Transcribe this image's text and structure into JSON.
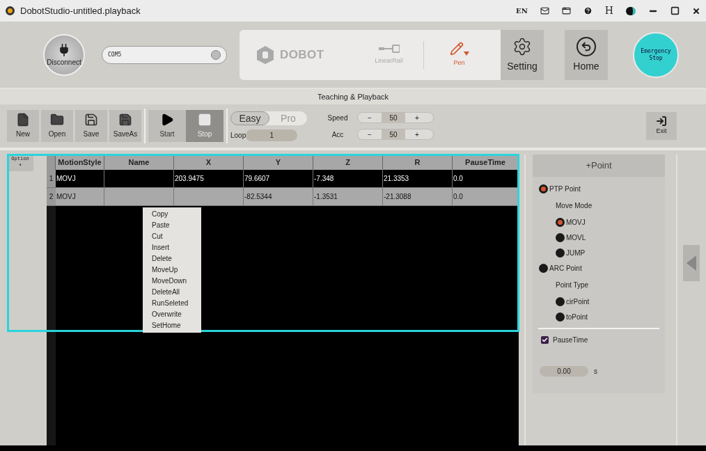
{
  "window": {
    "title": "DobotStudio-untitled.playback",
    "language": "EN",
    "help_letter": "H"
  },
  "connection": {
    "button": "Disconnect",
    "port": "COM5"
  },
  "device_bar": {
    "logo": "DOBOT",
    "tools": [
      {
        "label": "LinearRail",
        "selected": false
      },
      {
        "label": "Pen",
        "selected": true
      }
    ]
  },
  "nav_buttons": [
    {
      "label": "Setting",
      "kind": "setting"
    },
    {
      "label": "Home",
      "kind": "home"
    }
  ],
  "emergency_stop": "Emergency Stop",
  "section_title": "Teaching & Playback",
  "file_tools": [
    {
      "label": "New",
      "kind": "new"
    },
    {
      "label": "Open",
      "kind": "open"
    },
    {
      "label": "Save",
      "kind": "save"
    },
    {
      "label": "SaveAs",
      "kind": "saveas"
    }
  ],
  "run_tools": [
    {
      "label": "Start",
      "kind": "start",
      "disabled": false
    },
    {
      "label": "Stop",
      "kind": "stop",
      "disabled": true
    }
  ],
  "mode_tabs": [
    {
      "label": "Easy",
      "selected": true
    },
    {
      "label": "Pro",
      "selected": false
    }
  ],
  "loop": {
    "label": "Loop",
    "value": "1"
  },
  "steppers": [
    {
      "label": "Speed",
      "minus": "−",
      "value": "50",
      "plus": "+"
    },
    {
      "label": "Acc",
      "minus": "−",
      "value": "50",
      "plus": "+"
    }
  ],
  "exit": "Exit",
  "option": {
    "label": "Option",
    "caret": "▾"
  },
  "table": {
    "columns": [
      "MotionStyle",
      "Name",
      "X",
      "Y",
      "Z",
      "R",
      "PauseTime"
    ],
    "rows": [
      {
        "number": "1",
        "selected": false,
        "cells": [
          "MOVJ",
          "",
          "203.9475",
          "79.6607",
          "-7.348",
          "21.3353",
          "0.0"
        ]
      },
      {
        "number": "2",
        "selected": true,
        "cells": [
          "MOVJ",
          "",
          "",
          "-82.5344",
          "-1.3531",
          "-21.3088",
          "0.0"
        ]
      }
    ]
  },
  "context_menu": [
    "Copy",
    "Paste",
    "Cut",
    "Insert",
    "Delete",
    "MoveUp",
    "MoveDown",
    "DeleteAll",
    "RunSeleted",
    "Overwrite",
    "SetHome"
  ],
  "point_panel": {
    "add_button": "+Point",
    "point_types": [
      {
        "label": "PTP Point",
        "selected": true,
        "sub_heading": "Move Mode",
        "children": [
          {
            "label": "MOVJ",
            "selected": true
          },
          {
            "label": "MOVL",
            "selected": false
          },
          {
            "label": "JUMP",
            "selected": false
          }
        ]
      },
      {
        "label": "ARC Point",
        "selected": false,
        "sub_heading": "Point Type",
        "children": [
          {
            "label": "cirPoint",
            "selected": false
          },
          {
            "label": "toPoint",
            "selected": false
          }
        ]
      }
    ],
    "pause_time": {
      "label": "PauseTime",
      "checked": true,
      "value": "0.00",
      "unit": "s"
    }
  }
}
